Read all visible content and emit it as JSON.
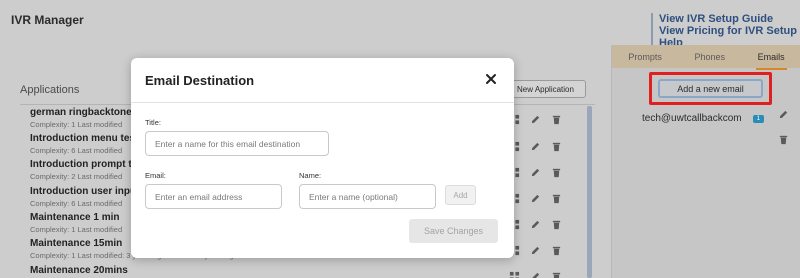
{
  "app": {
    "title": "IVR Manager",
    "links": [
      "View IVR Setup Guide",
      "View Pricing for IVR Setup Help"
    ]
  },
  "right_panel": {
    "tabs": [
      {
        "label": "Prompts",
        "active": false
      },
      {
        "label": "Phones",
        "active": false
      },
      {
        "label": "Emails",
        "active": true
      }
    ],
    "add_button": "Add a new email",
    "email": "tech@uwtcallbackcom",
    "email_badge": "1"
  },
  "applications": {
    "title": "Applications",
    "new_button": "New Application",
    "items": [
      {
        "name": "german ringbacktone tes",
        "meta": "Complexity: 1 Last modified"
      },
      {
        "name": "Introduction menu testin",
        "meta": "Complexity: 6 Last modified"
      },
      {
        "name": "Introduction prompt test",
        "meta": "Complexity: 2 Last modified"
      },
      {
        "name": "Introduction user input t",
        "meta": "Complexity: 6 Last modified"
      },
      {
        "name": "Maintenance 1 min",
        "meta": "Complexity: 1 Last modified"
      },
      {
        "name": "Maintenance 15min",
        "meta": "Complexity: 1 Last modified: 3 years ago Created: 3 years ago"
      },
      {
        "name": "Maintenance 20mins",
        "meta": ""
      }
    ]
  },
  "modal": {
    "title": "Email Destination",
    "title_label": "Title:",
    "title_placeholder": "Enter a name for this email destination",
    "email_label": "Email:",
    "email_placeholder": "Enter an email address",
    "name_label": "Name:",
    "name_placeholder": "Enter a name (optional)",
    "add_button": "Add",
    "save_button": "Save Changes"
  },
  "colors": {
    "highlight": "#e02020",
    "accent": "#d9862a",
    "badge": "#2a8db8"
  }
}
